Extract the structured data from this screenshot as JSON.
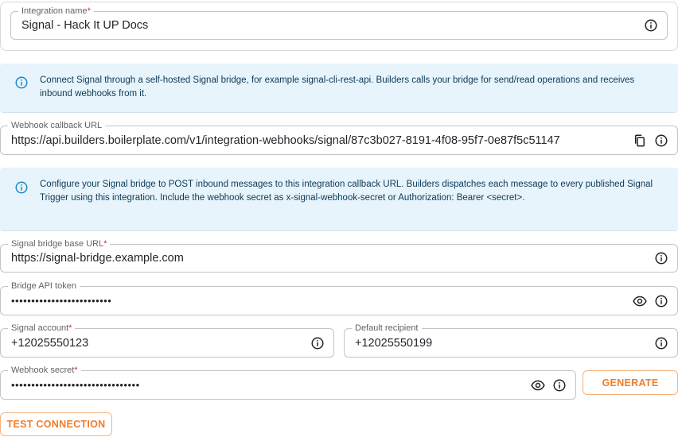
{
  "integration_name": {
    "label": "Integration name",
    "required_mark": "*",
    "value": "Signal - Hack It UP Docs"
  },
  "alert_connect": {
    "text": "Connect Signal through a self-hosted Signal bridge, for example signal-cli-rest-api. Builders calls your bridge for send/read operations and receives inbound webhooks from it."
  },
  "webhook_callback": {
    "label": "Webhook callback URL",
    "value": "https://api.builders.boilerplate.com/v1/integration-webhooks/signal/87c3b027-8191-4f08-95f7-0e87f5c51147"
  },
  "alert_configure": {
    "text": "Configure your Signal bridge to POST inbound messages to this integration callback URL. Builders dispatches each message to every published Signal Trigger using this integration. Include the webhook secret as x-signal-webhook-secret or Authorization: Bearer <secret>."
  },
  "bridge_base_url": {
    "label": "Signal bridge base URL",
    "required_mark": "*",
    "value": "https://signal-bridge.example.com"
  },
  "bridge_api_token": {
    "label": "Bridge API token",
    "value": "•••••••••••••••••••••••••"
  },
  "signal_account": {
    "label": "Signal account",
    "required_mark": "*",
    "value": "+12025550123"
  },
  "default_recipient": {
    "label": "Default recipient",
    "value": "+12025550199"
  },
  "webhook_secret": {
    "label": "Webhook secret",
    "required_mark": "*",
    "value": "••••••••••••••••••••••••••••••••"
  },
  "buttons": {
    "generate": "GENERATE",
    "test_connection": "TEST CONNECTION"
  },
  "colors": {
    "accent": "#ef7d2c",
    "accent_border": "#f4b27e",
    "info_bg": "#e8f4fb",
    "info_icon": "#1e88c8",
    "required": "#d32f2f"
  }
}
